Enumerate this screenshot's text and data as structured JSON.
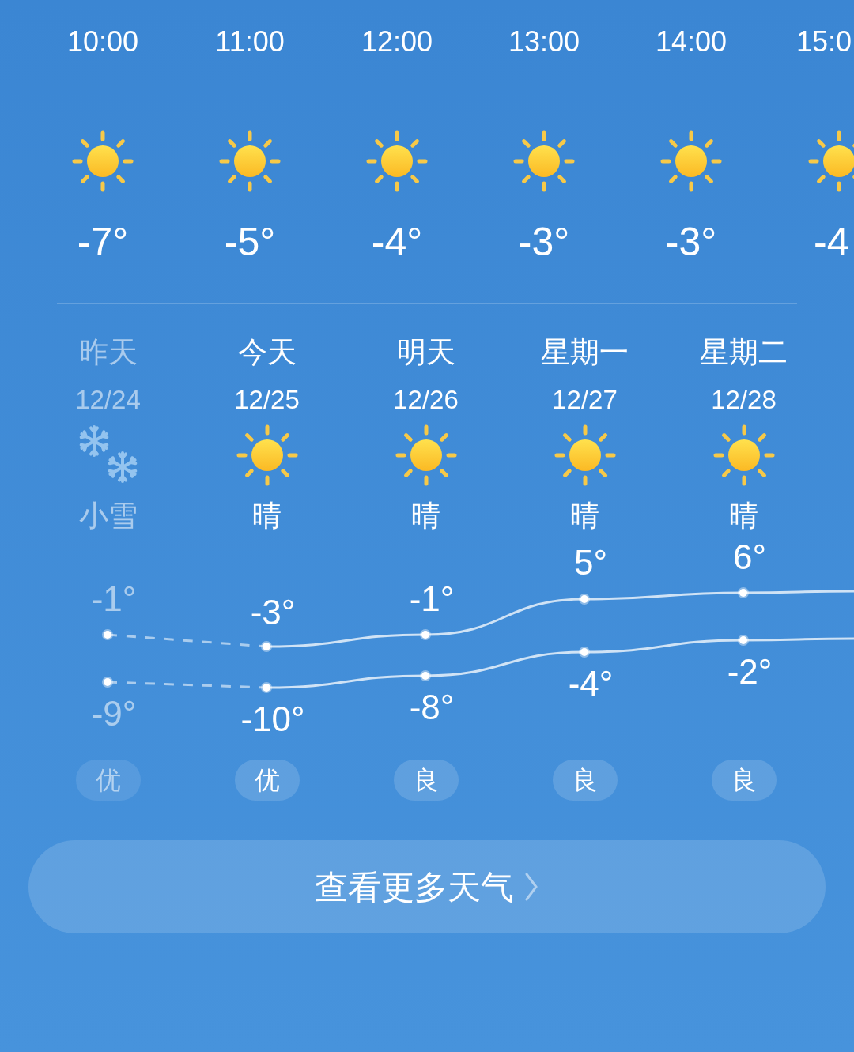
{
  "hourly": [
    {
      "time": "10:00",
      "kind": "sunny",
      "temp": "-7°"
    },
    {
      "time": "11:00",
      "kind": "sunny",
      "temp": "-5°"
    },
    {
      "time": "12:00",
      "kind": "sunny",
      "temp": "-4°"
    },
    {
      "time": "13:00",
      "kind": "sunny",
      "temp": "-3°"
    },
    {
      "time": "14:00",
      "kind": "sunny",
      "temp": "-3°"
    },
    {
      "time": "15:0",
      "kind": "sunny",
      "temp": "-4"
    }
  ],
  "daily": [
    {
      "day": "昨天",
      "date": "12/24",
      "kind": "snow",
      "condition": "小雪",
      "high": "-1°",
      "low": "-9°",
      "aqi": "优",
      "past": true
    },
    {
      "day": "今天",
      "date": "12/25",
      "kind": "sunny",
      "condition": "晴",
      "high": "-3°",
      "low": "-10°",
      "aqi": "优",
      "past": false
    },
    {
      "day": "明天",
      "date": "12/26",
      "kind": "sunny",
      "condition": "晴",
      "high": "-1°",
      "low": "-8°",
      "aqi": "良",
      "past": false
    },
    {
      "day": "星期一",
      "date": "12/27",
      "kind": "sunny",
      "condition": "晴",
      "high": "5°",
      "low": "-4°",
      "aqi": "良",
      "past": false
    },
    {
      "day": "星期二",
      "date": "12/28",
      "kind": "sunny",
      "condition": "晴",
      "high": "6°",
      "low": "-2°",
      "aqi": "良",
      "past": false
    }
  ],
  "more_button": {
    "label": "查看更多天气"
  }
}
